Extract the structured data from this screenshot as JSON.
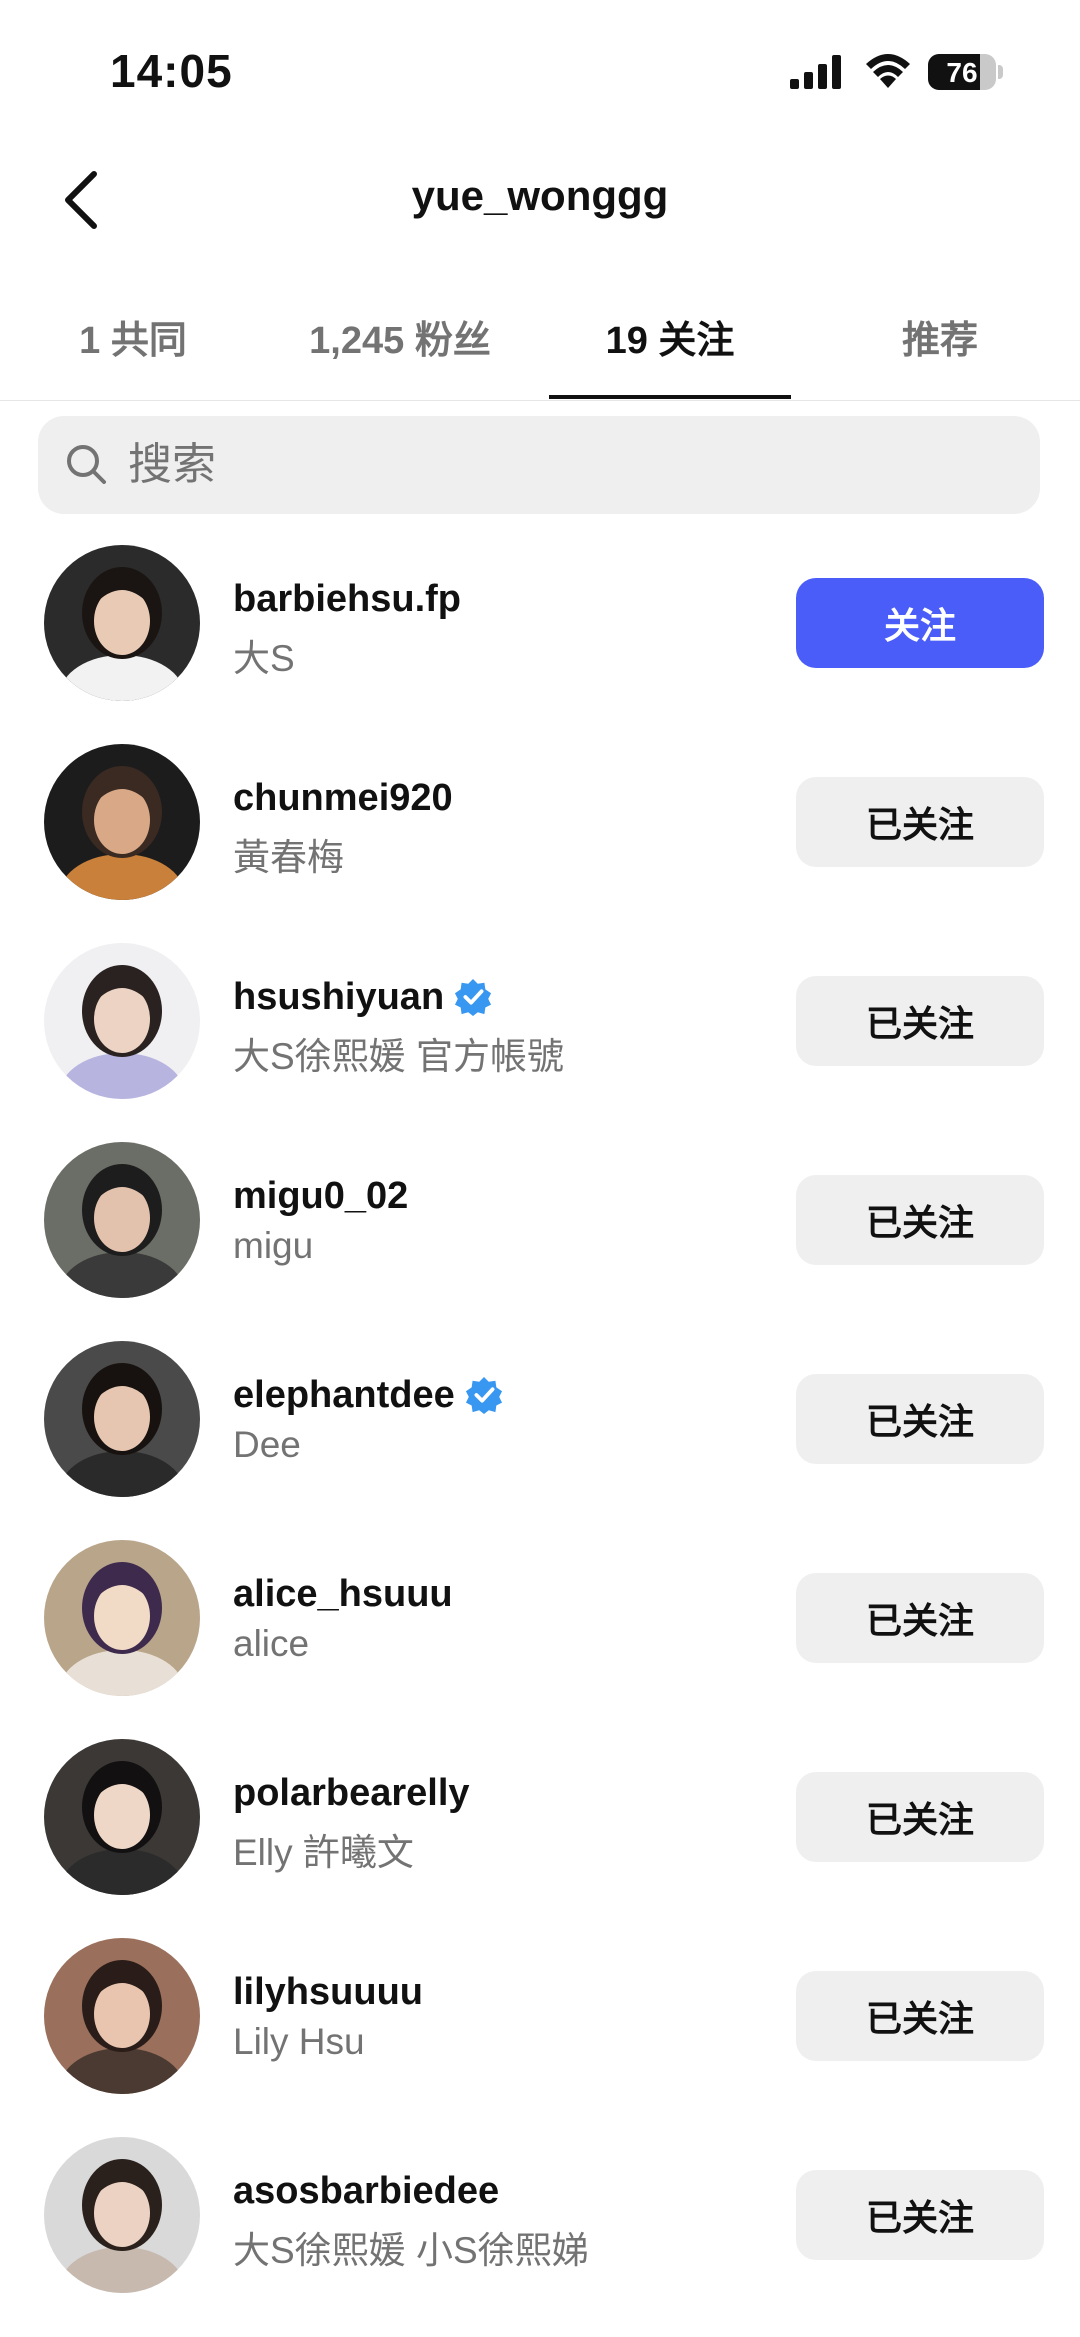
{
  "status_bar": {
    "time": "14:05",
    "battery": "76",
    "battery_level": 0.76
  },
  "header": {
    "title": "yue_wonggg"
  },
  "tabs": [
    {
      "label": "1 共同",
      "active": false
    },
    {
      "label": "1,245 粉丝",
      "active": false
    },
    {
      "label": "19 关注",
      "active": true
    },
    {
      "label": "推荐",
      "active": false
    }
  ],
  "search": {
    "placeholder": "搜索"
  },
  "colors": {
    "accent": "#4a5df9",
    "verified": "#3897f0",
    "secondary_text": "#737373",
    "button_gray": "#efeff0"
  },
  "accounts": [
    {
      "username": "barbiehsu.fp",
      "name": "大S",
      "verified": false,
      "button": "关注",
      "following": false
    },
    {
      "username": "chunmei920",
      "name": "黃春梅",
      "verified": false,
      "button": "已关注",
      "following": true
    },
    {
      "username": "hsushiyuan",
      "name": "大S徐熙媛  官方帳號",
      "verified": true,
      "button": "已关注",
      "following": true
    },
    {
      "username": "migu0_02",
      "name": "migu",
      "verified": false,
      "button": "已关注",
      "following": true
    },
    {
      "username": "elephantdee",
      "name": "Dee",
      "verified": true,
      "button": "已关注",
      "following": true
    },
    {
      "username": "alice_hsuuu",
      "name": "alice",
      "verified": false,
      "button": "已关注",
      "following": true
    },
    {
      "username": "polarbearelly",
      "name": "Elly 許曦文",
      "verified": false,
      "button": "已关注",
      "following": true
    },
    {
      "username": "lilyhsuuuu",
      "name": "Lily Hsu",
      "verified": false,
      "button": "已关注",
      "following": true
    },
    {
      "username": "asosbarbiedee",
      "name": "大S徐熙媛 小S徐熙娣",
      "verified": false,
      "button": "已关注",
      "following": true
    }
  ]
}
